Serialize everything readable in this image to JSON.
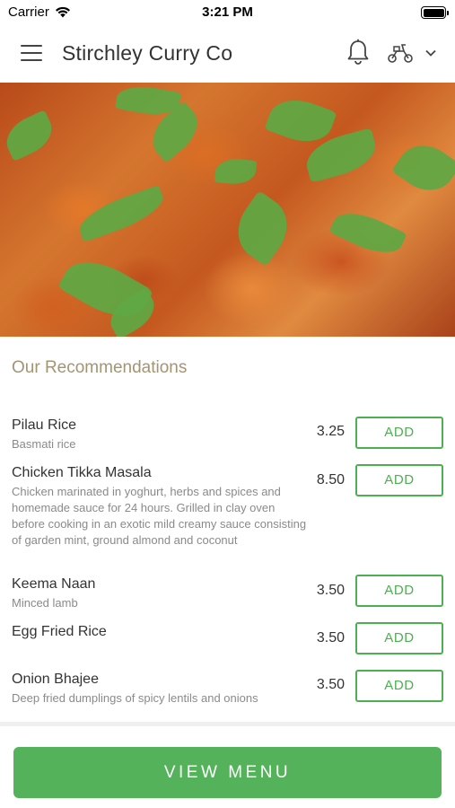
{
  "status_bar": {
    "carrier": "Carrier",
    "time": "3:21 PM"
  },
  "header": {
    "title": "Stirchley Curry Co",
    "icons": [
      "menu-icon",
      "bell-icon",
      "scooter-icon",
      "chevron-down-icon"
    ]
  },
  "hero": {
    "image": "curry-dish-photo"
  },
  "recommendations": {
    "title": "Our Recommendations",
    "items": [
      {
        "name": "Pilau Rice",
        "description": "Basmati rice",
        "price": "3.25",
        "button": "ADD"
      },
      {
        "name": "Chicken Tikka Masala",
        "description": "Chicken marinated in yoghurt, herbs and spices and homemade sauce for 24 hours. Grilled in clay oven before cooking in an exotic mild creamy sauce consisting of garden mint, ground almond and coconut",
        "price": "8.50",
        "button": "ADD"
      },
      {
        "name": "Keema Naan",
        "description": "Minced lamb",
        "price": "3.50",
        "button": "ADD"
      },
      {
        "name": "Egg Fried Rice",
        "description": "",
        "price": "3.50",
        "button": "ADD"
      },
      {
        "name": "Onion Bhajee",
        "description": "Deep fried dumplings of spicy lentils and onions",
        "price": "3.50",
        "button": "ADD"
      }
    ]
  },
  "footer": {
    "view_menu_label": "VIEW MENU"
  },
  "colors": {
    "accent_green": "#4caf50",
    "button_green": "#54b35a",
    "section_title": "#a39473"
  }
}
